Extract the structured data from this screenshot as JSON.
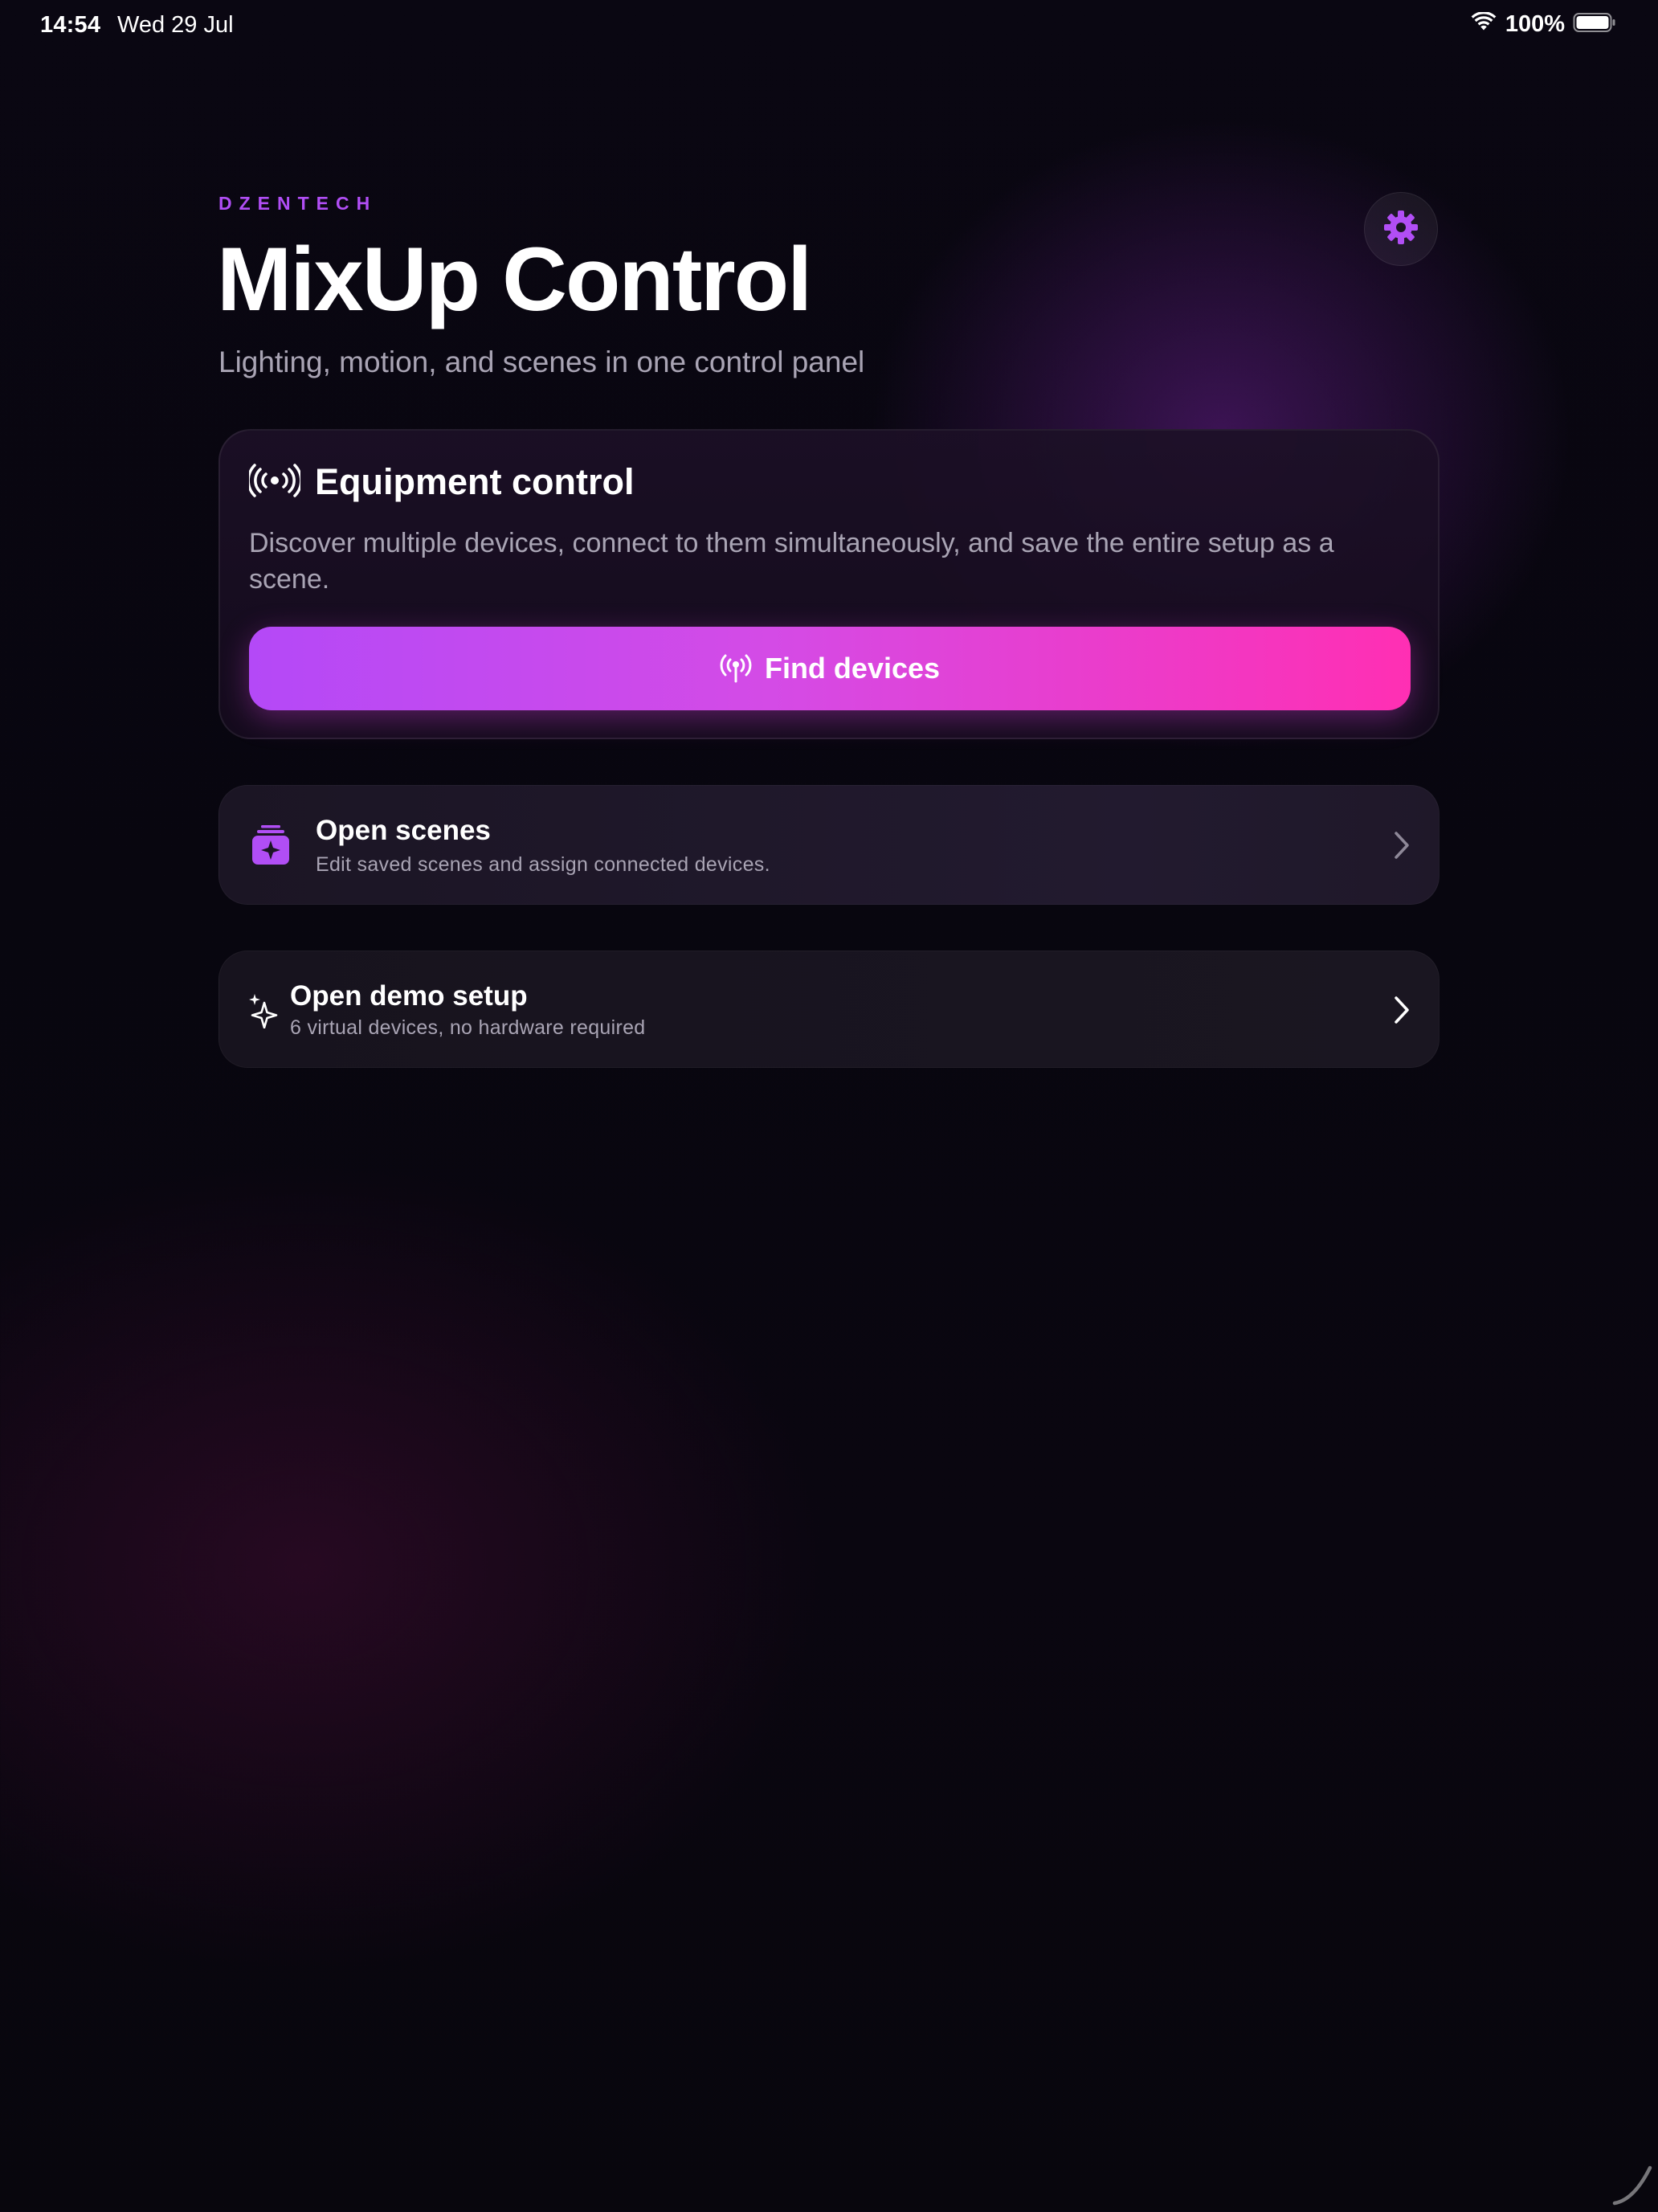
{
  "status_bar": {
    "time": "14:54",
    "date": "Wed 29 Jul",
    "battery_percent": "100%",
    "wifi_icon": "wifi-icon",
    "battery_icon": "battery-icon"
  },
  "header": {
    "brand": "DZENTECH",
    "title": "MixUp Control",
    "subtitle": "Lighting, motion, and scenes in one control panel",
    "settings_icon": "gear-icon"
  },
  "equipment_card": {
    "icon": "broadcast-icon",
    "title": "Equipment control",
    "description": "Discover multiple devices, connect to them simultaneously, and save the entire setup as a scene.",
    "button": {
      "label": "Find devices",
      "icon": "antenna-icon"
    }
  },
  "rows": {
    "scenes": {
      "icon": "scenes-stack-icon",
      "title": "Open scenes",
      "subtitle": "Edit saved scenes and assign connected devices."
    },
    "demo": {
      "icon": "sparkles-icon",
      "title": "Open demo setup",
      "subtitle": "6 virtual devices, no hardware required"
    }
  },
  "colors": {
    "accent": "#b14ef5",
    "gradient_start": "#b449f7",
    "gradient_end": "#ff2fb3",
    "background": "#07050f",
    "muted_text": "#a9a4b4"
  }
}
